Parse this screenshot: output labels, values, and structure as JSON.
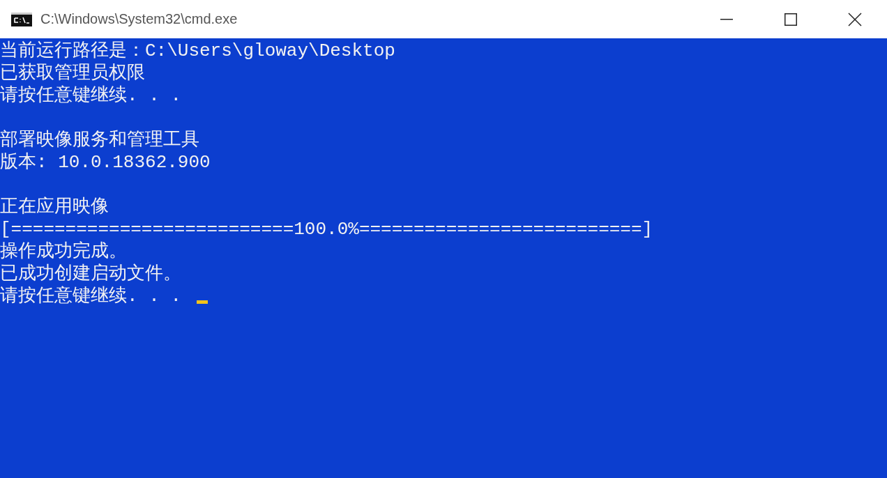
{
  "window": {
    "title": "C:\\Windows\\System32\\cmd.exe"
  },
  "console": {
    "lines": [
      {
        "kind": "text",
        "text": "当前运行路径是：C:\\Users\\gloway\\Desktop"
      },
      {
        "kind": "text",
        "text": "已获取管理员权限"
      },
      {
        "kind": "text",
        "text": "请按任意键继续. . ."
      },
      {
        "kind": "blank"
      },
      {
        "kind": "text",
        "text": "部署映像服务和管理工具"
      },
      {
        "kind": "text",
        "text": "版本: 10.0.18362.900"
      },
      {
        "kind": "blank"
      },
      {
        "kind": "text",
        "text": "正在应用映像"
      },
      {
        "kind": "text",
        "text": "[==========================100.0%==========================]"
      },
      {
        "kind": "text",
        "text": "操作成功完成。"
      },
      {
        "kind": "text",
        "text": "已成功创建启动文件。"
      },
      {
        "kind": "text",
        "text": "请按任意键继续. . .",
        "cursor": true
      }
    ]
  }
}
